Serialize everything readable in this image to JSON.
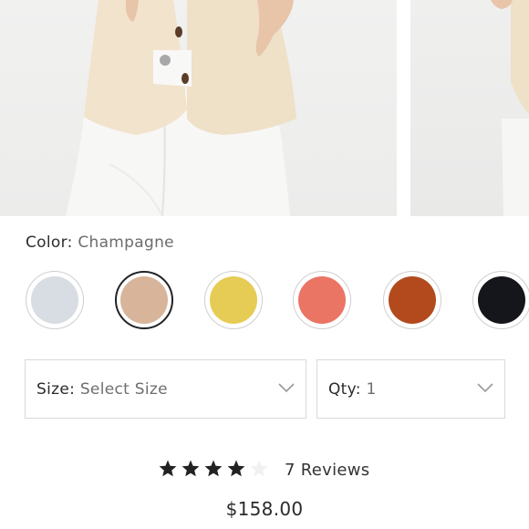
{
  "product": {
    "color_label": "Color:",
    "color_value": "Champagne",
    "swatches": [
      {
        "name": "light-blue",
        "color": "#d7dde2",
        "selected": false
      },
      {
        "name": "champagne",
        "color": "#d8b59a",
        "selected": true
      },
      {
        "name": "yellow",
        "color": "#e6cc55",
        "selected": false
      },
      {
        "name": "coral",
        "color": "#ea7564",
        "selected": false
      },
      {
        "name": "rust",
        "color": "#b24a1e",
        "selected": false
      },
      {
        "name": "black",
        "color": "#15151c",
        "selected": false
      }
    ],
    "size_label": "Size:",
    "size_value": "Select Size",
    "qty_label": "Qty:",
    "qty_value": "1",
    "rating": 4,
    "rating_max": 5,
    "reviews_text": "7 Reviews",
    "price": "$158.00"
  },
  "icons": {
    "dropdown": "chevron-down-icon",
    "star": "star-icon"
  }
}
